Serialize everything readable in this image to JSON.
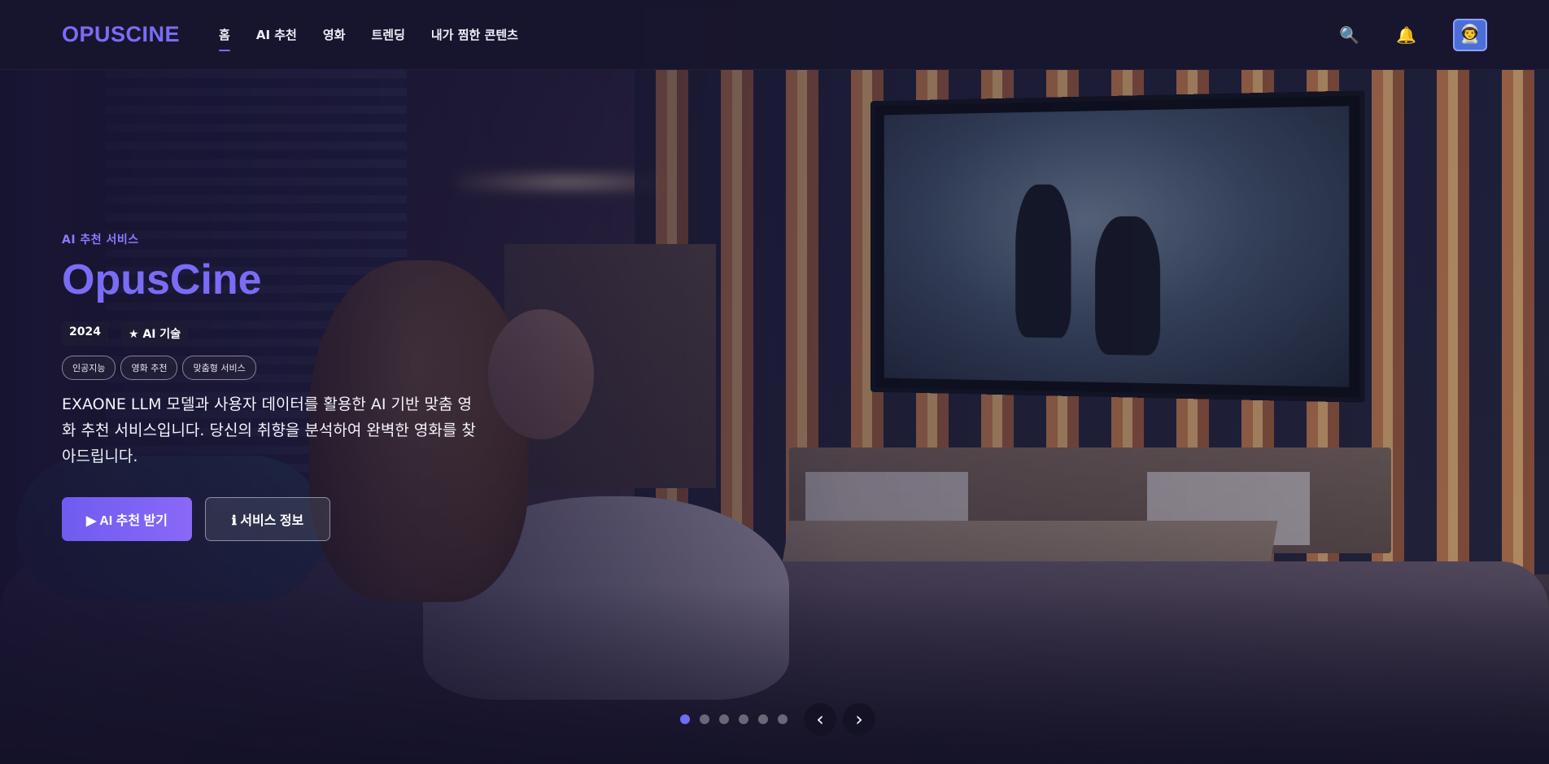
{
  "nav": {
    "logo": "OPUSCINE",
    "links": [
      {
        "label": "홈",
        "active": true
      },
      {
        "label": "AI 추천",
        "active": false
      },
      {
        "label": "영화",
        "active": false
      },
      {
        "label": "트렌딩",
        "active": false
      },
      {
        "label": "내가 찜한 콘텐츠",
        "active": false
      }
    ],
    "icons": {
      "search": "search-icon",
      "notifications": "bell-icon",
      "profile": "astronaut-avatar"
    }
  },
  "hero": {
    "eyebrow": "AI 추천 서비스",
    "title": "OpusCine",
    "year": "2024",
    "badge": "★ AI 기술",
    "tags": [
      "인공지능",
      "영화 추천",
      "맞춤형 서비스"
    ],
    "description": "EXAONE LLM 모델과 사용자 데이터를 활용한 AI 기반 맞춤 영화 추천 서비스입니다. 당신의 취향을 분석하여 완벽한 영화를 찾아드립니다.",
    "primary_button": "▶ AI 추천 받기",
    "secondary_button": "ℹ 서비스 정보"
  },
  "carousel": {
    "total_slides": 6,
    "active_index": 0,
    "prev": "‹",
    "next": "›"
  },
  "colors": {
    "accent": "#7b6cf6",
    "nav_bg": "#18162e"
  }
}
